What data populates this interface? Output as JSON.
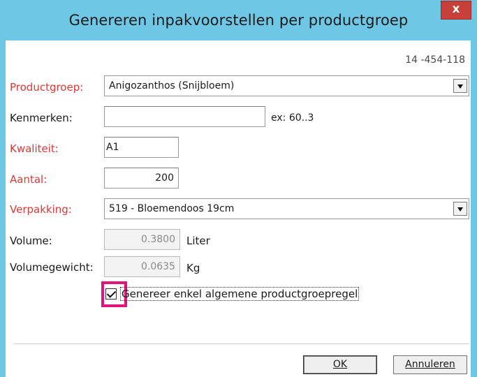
{
  "window": {
    "title": "Genereren inpakvoorstellen per productgroep",
    "close_label": "x",
    "reference": "14 -454-118"
  },
  "form": {
    "productgroep": {
      "label": "Productgroep:",
      "value": "Anigozanthos (Snijbloem)"
    },
    "kenmerken": {
      "label": "Kenmerken:",
      "value": "",
      "hint": "ex: 60..3"
    },
    "kwaliteit": {
      "label": "Kwaliteit:",
      "value": "A1"
    },
    "aantal": {
      "label": "Aantal:",
      "value": "200"
    },
    "verpakking": {
      "label": "Verpakking:",
      "value": "519 - Bloemendoos 19cm"
    },
    "volume": {
      "label": "Volume:",
      "value": "0.3800",
      "unit": "Liter"
    },
    "volumegewicht": {
      "label": "Volumegewicht:",
      "value": "0.0635",
      "unit": "Kg"
    },
    "checkbox": {
      "label": "Genereer enkel algemene productgroepregel",
      "checked": true
    }
  },
  "buttons": {
    "ok": "OK",
    "cancel": "Annuleren"
  },
  "colors": {
    "required_label": "#d83a3a",
    "title_bar": "#6fc7e6",
    "close_button": "#c7403a",
    "highlight": "#e0157a"
  }
}
